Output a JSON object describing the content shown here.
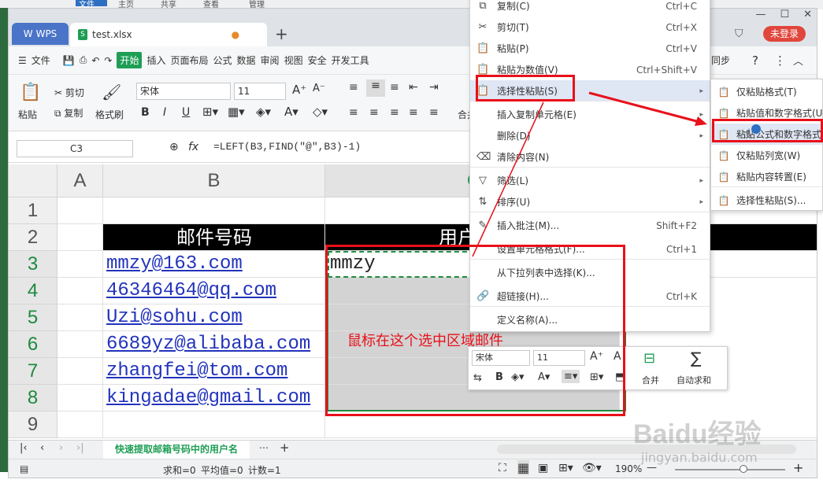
{
  "bg_menu": {
    "file": "文件",
    "home": "主页",
    "share": "共享",
    "view": "查看",
    "manage": "管理"
  },
  "tabs": {
    "wps": "WPS",
    "file": "test.xlsx",
    "login": "未登录"
  },
  "menubar": {
    "file": "文件",
    "start": "开始",
    "insert": "插入",
    "layout": "页面布局",
    "formula": "公式",
    "data": "数据",
    "review": "审阅",
    "view": "视图",
    "security": "安全",
    "dev": "开发工具",
    "sync": "同步"
  },
  "ribbon": {
    "paste": "粘贴",
    "cut": "剪切",
    "copy": "复制",
    "format_painter": "格式刷",
    "font": "宋体",
    "size": "11",
    "merge": "合并"
  },
  "formula": {
    "cell_ref": "C3",
    "fx": "fx",
    "content": "=LEFT(B3,FIND(\"@\",B3)-1)"
  },
  "grid": {
    "cols": [
      "A",
      "B",
      "C"
    ],
    "rows": [
      "1",
      "2",
      "3",
      "4",
      "5",
      "6",
      "7",
      "8",
      "9"
    ],
    "header_b": "邮件号码",
    "header_c": "用户",
    "emails": [
      "mmzy@163.com",
      "46346464@qq.com",
      "Uzi@sohu.com",
      "6689yz@alibaba.com",
      "zhangfei@tom.com",
      "kingadae@gmail.com"
    ],
    "c3": "mmzy",
    "annotation": "鼠标在这个选中区域邮件"
  },
  "context_menu": [
    {
      "icon": "copy-icon",
      "glyph": "⧉",
      "label": "复制(C)",
      "shortcut": "Ctrl+C"
    },
    {
      "icon": "cut-icon",
      "glyph": "✂",
      "label": "剪切(T)",
      "shortcut": "Ctrl+X"
    },
    {
      "icon": "paste-icon",
      "glyph": "📋",
      "label": "粘贴(P)",
      "shortcut": "Ctrl+V"
    },
    {
      "icon": "paste-values-icon",
      "glyph": "📋",
      "label": "粘贴为数值(V)",
      "shortcut": "Ctrl+Shift+V"
    },
    {
      "icon": "paste-special-icon",
      "glyph": "📋",
      "label": "选择性粘贴(S)",
      "shortcut": ""
    },
    {
      "icon": "insert-copied-icon",
      "glyph": "",
      "label": "插入复制单元格(E)",
      "shortcut": ""
    },
    {
      "icon": "delete-icon",
      "glyph": "",
      "label": "删除(D)",
      "shortcut": ""
    },
    {
      "icon": "clear-icon",
      "glyph": "⌫",
      "label": "清除内容(N)",
      "shortcut": ""
    },
    {
      "icon": "filter-icon",
      "glyph": "▽",
      "label": "筛选(L)",
      "shortcut": ""
    },
    {
      "icon": "sort-icon",
      "glyph": "⇅",
      "label": "排序(U)",
      "shortcut": ""
    },
    {
      "icon": "comment-icon",
      "glyph": "✎",
      "label": "插入批注(M)...",
      "shortcut": "Shift+F2"
    },
    {
      "icon": "format-cells-icon",
      "glyph": "",
      "label": "设置单元格格式(F)...",
      "shortcut": "Ctrl+1"
    },
    {
      "icon": "dropdown-pick-icon",
      "glyph": "",
      "label": "从下拉列表中选择(K)...",
      "shortcut": ""
    },
    {
      "icon": "hyperlink-icon",
      "glyph": "🔗",
      "label": "超链接(H)...",
      "shortcut": "Ctrl+K"
    },
    {
      "icon": "define-name-icon",
      "glyph": "",
      "label": "定义名称(A)...",
      "shortcut": ""
    }
  ],
  "submenu": [
    {
      "icon": "paste-format-icon",
      "label": "仅粘贴格式(T)"
    },
    {
      "icon": "paste-values-numformat-icon",
      "label": "粘贴值和数字格式(U)"
    },
    {
      "icon": "paste-formula-numformat-icon",
      "label": "粘贴公式和数字格式"
    },
    {
      "icon": "paste-colwidth-icon",
      "label": "仅粘贴列宽(W)"
    },
    {
      "icon": "transpose-icon",
      "label": "粘贴内容转置(E)"
    },
    {
      "icon": "paste-special-more-icon",
      "label": "选择性粘贴(S)..."
    }
  ],
  "mini_toolbar": {
    "font": "宋体",
    "size": "11",
    "merge": "合并",
    "autosum": "自动求和"
  },
  "sheet": {
    "tab": "快速提取邮箱号码中的用户名"
  },
  "status": {
    "sum": "求和=0",
    "avg": "平均值=0",
    "count": "计数=1",
    "zoom": "190%"
  },
  "watermark": {
    "brand": "Baidu经验",
    "url": "jingyan.baidu.com"
  }
}
